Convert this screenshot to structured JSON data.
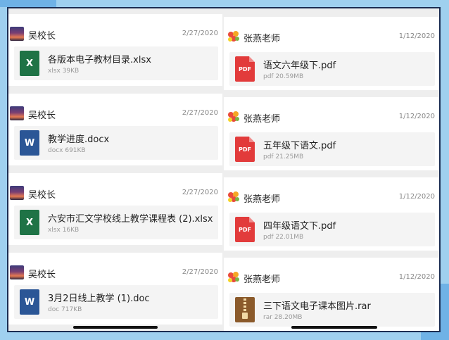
{
  "left": [
    {
      "sender": "吴校长",
      "date": "2/27/2020",
      "file": {
        "name": "各版本电子教材目录.xlsx",
        "meta": "xlsx 39KB",
        "type": "xlsx",
        "glyph": "X"
      }
    },
    {
      "sender": "吴校长",
      "date": "2/27/2020",
      "file": {
        "name": "教学进度.docx",
        "meta": "docx 691KB",
        "type": "docx",
        "glyph": "W"
      }
    },
    {
      "sender": "吴校长",
      "date": "2/27/2020",
      "file": {
        "name": "六安市汇文学校线上教学课程表 (2).xlsx",
        "meta": "xlsx 16KB",
        "type": "xlsx",
        "glyph": "X"
      }
    },
    {
      "sender": "吴校长",
      "date": "2/27/2020",
      "file": {
        "name": "3月2日线上教学 (1).doc",
        "meta": "doc 717KB",
        "type": "docx",
        "glyph": "W"
      }
    }
  ],
  "right": [
    {
      "sender": "张燕老师",
      "date": "1/12/2020",
      "file": {
        "name": "语文六年级下.pdf",
        "meta": "pdf 20.59MB",
        "type": "pdf",
        "glyph": "PDF"
      }
    },
    {
      "sender": "张燕老师",
      "date": "1/12/2020",
      "file": {
        "name": "五年级下语文.pdf",
        "meta": "pdf 21.25MB",
        "type": "pdf",
        "glyph": "PDF"
      }
    },
    {
      "sender": "张燕老师",
      "date": "1/12/2020",
      "file": {
        "name": "四年级语文下.pdf",
        "meta": "pdf 22.01MB",
        "type": "pdf",
        "glyph": "PDF"
      }
    },
    {
      "sender": "张燕老师",
      "date": "1/12/2020",
      "file": {
        "name": "三下语文电子课本图片.rar",
        "meta": "rar 28.20MB",
        "type": "rar",
        "glyph": ""
      }
    }
  ]
}
